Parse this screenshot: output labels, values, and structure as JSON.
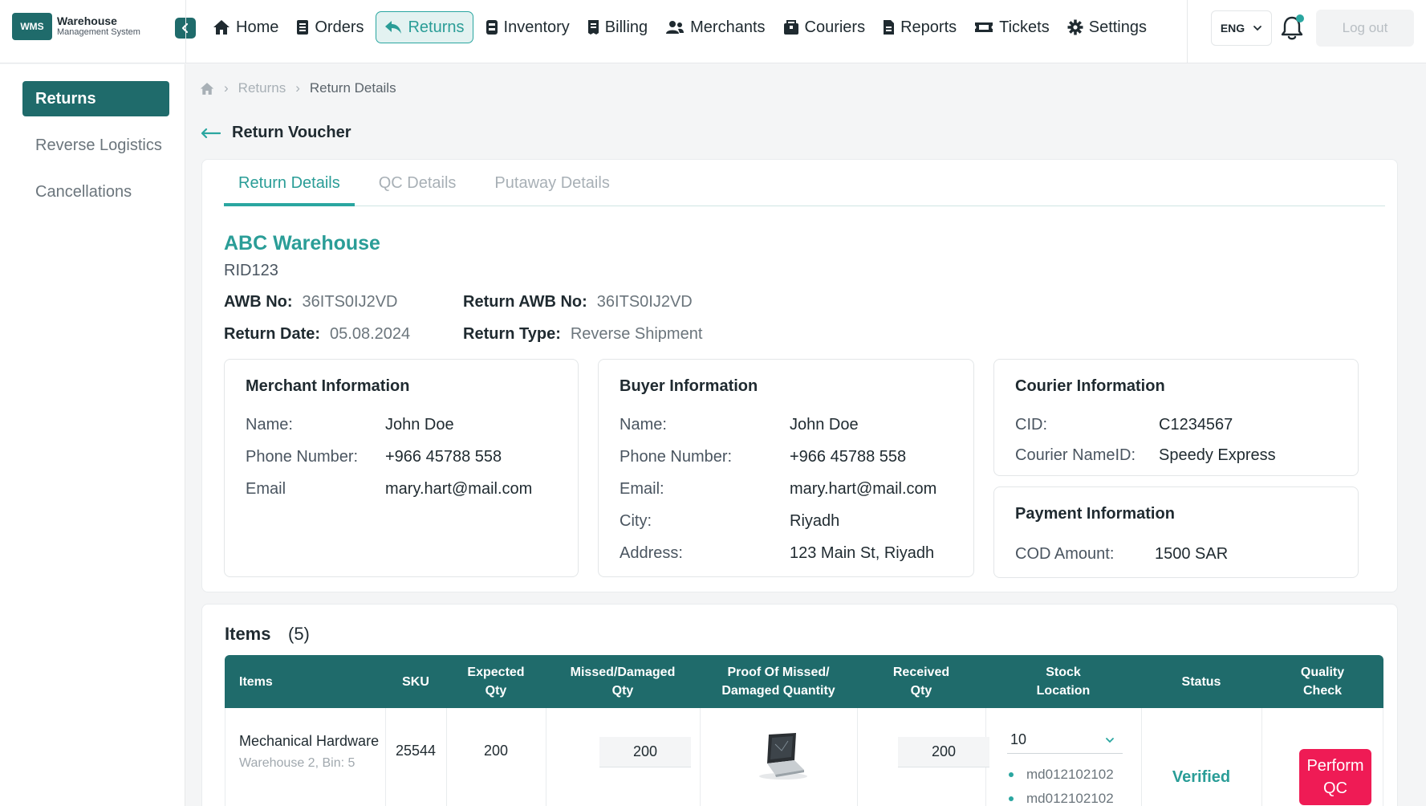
{
  "app": {
    "logo_badge": "WMS",
    "logo_title": "Warehouse",
    "logo_subtitle": "Management System"
  },
  "nav": {
    "items": [
      {
        "label": "Home",
        "icon": "home-icon",
        "active": false
      },
      {
        "label": "Orders",
        "icon": "orders-icon",
        "active": false
      },
      {
        "label": "Returns",
        "icon": "returns-icon",
        "active": true
      },
      {
        "label": "Inventory",
        "icon": "inventory-icon",
        "active": false
      },
      {
        "label": "Billing",
        "icon": "billing-icon",
        "active": false
      },
      {
        "label": "Merchants",
        "icon": "merchants-icon",
        "active": false
      },
      {
        "label": "Couriers",
        "icon": "couriers-icon",
        "active": false
      },
      {
        "label": "Reports",
        "icon": "reports-icon",
        "active": false
      },
      {
        "label": "Tickets",
        "icon": "tickets-icon",
        "active": false
      },
      {
        "label": "Settings",
        "icon": "gear-icon",
        "active": false
      }
    ],
    "language": "ENG",
    "logout_label": "Log out"
  },
  "sidebar": {
    "items": [
      {
        "label": "Returns",
        "active": true
      },
      {
        "label": "Reverse Logistics",
        "active": false
      },
      {
        "label": "Cancellations",
        "active": false
      }
    ]
  },
  "breadcrumb": {
    "items": [
      "Returns",
      "Return Details"
    ]
  },
  "page": {
    "title": "Return Voucher"
  },
  "tabs": [
    {
      "label": "Return Details",
      "active": true
    },
    {
      "label": "QC Details",
      "active": false
    },
    {
      "label": "Putaway Details",
      "active": false
    }
  ],
  "return": {
    "warehouse": "ABC Warehouse",
    "rid": "RID123",
    "awb_label": "AWB No:",
    "awb_value": "36ITS0IJ2VD",
    "return_awb_label": "Return AWB No:",
    "return_awb_value": "36ITS0IJ2VD",
    "date_label": "Return Date:",
    "date_value": "05.08.2024",
    "type_label": "Return Type:",
    "type_value": "Reverse Shipment"
  },
  "merchant": {
    "title": "Merchant Information",
    "rows": [
      {
        "label": "Name:",
        "value": "John Doe"
      },
      {
        "label": "Phone Number:",
        "value": "+966 45788 558"
      },
      {
        "label": "Email",
        "value": "mary.hart@mail.com"
      }
    ]
  },
  "buyer": {
    "title": "Buyer Information",
    "rows": [
      {
        "label": "Name:",
        "value": "John Doe"
      },
      {
        "label": "Phone Number:",
        "value": "+966 45788 558"
      },
      {
        "label": "Email:",
        "value": "mary.hart@mail.com"
      },
      {
        "label": "City:",
        "value": "Riyadh"
      },
      {
        "label": "Address:",
        "value": "123 Main St, Riyadh"
      }
    ]
  },
  "courier": {
    "title": "Courier Information",
    "rows": [
      {
        "label": "CID:",
        "value": "C1234567"
      },
      {
        "label": "Courier NameID:",
        "value": "Speedy Express"
      }
    ]
  },
  "payment": {
    "title": "Payment Information",
    "rows": [
      {
        "label": "COD Amount:",
        "value": "1500 SAR"
      }
    ]
  },
  "items": {
    "title": "Items",
    "count": "(5)",
    "headers": {
      "items": "Items",
      "sku": "SKU",
      "expected_1": "Expected",
      "expected_2": "Qty",
      "missed_1": "Missed/Damaged",
      "missed_2": "Qty",
      "proof_1": "Proof Of Missed/",
      "proof_2": "Damaged Quantity",
      "received_1": "Received",
      "received_2": "Qty",
      "stock_1": "Stock",
      "stock_2": "Location",
      "status": "Status",
      "qc_1": "Quality",
      "qc_2": "Check"
    },
    "rows": [
      {
        "name": "Mechanical Hardware",
        "location": "Warehouse 2, Bin: 5",
        "sku": "25544",
        "expected": "200",
        "missed": "200",
        "received": "200",
        "stock_selected": "10",
        "stock_list": [
          "md012102102",
          "md012102102"
        ],
        "status": "Verified",
        "qc_1": "Perform",
        "qc_2": "QC"
      }
    ]
  },
  "colors": {
    "primary": "#1f6b6b",
    "accent": "#2aa6a0",
    "danger": "#ef1b55"
  }
}
